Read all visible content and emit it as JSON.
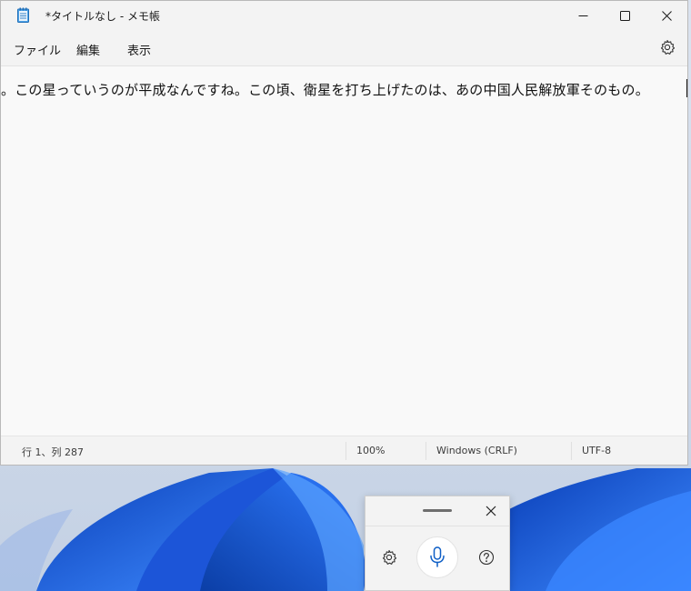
{
  "window": {
    "title": "*タイトルなし - メモ帳"
  },
  "menu": {
    "file": "ファイル",
    "edit": "編集",
    "view": "表示"
  },
  "editor": {
    "content": "。この星っていうのが平成なんですね。この頃、衛星を打ち上げたのは、あの中国人民解放軍そのもの。"
  },
  "statusbar": {
    "position": "行 1、列 287",
    "zoom": "100%",
    "line_ending": "Windows (CRLF)",
    "encoding": "UTF-8"
  },
  "icons": {
    "app": "notepad-icon",
    "minimize": "minimize-icon",
    "maximize": "maximize-icon",
    "close": "close-icon",
    "settings": "gear-icon",
    "voice_close": "close-icon",
    "voice_settings": "gear-icon",
    "voice_mic": "microphone-icon",
    "voice_help": "help-icon"
  },
  "colors": {
    "accent": "#0f5fc6",
    "wallpaper": "#1a5bd8"
  }
}
